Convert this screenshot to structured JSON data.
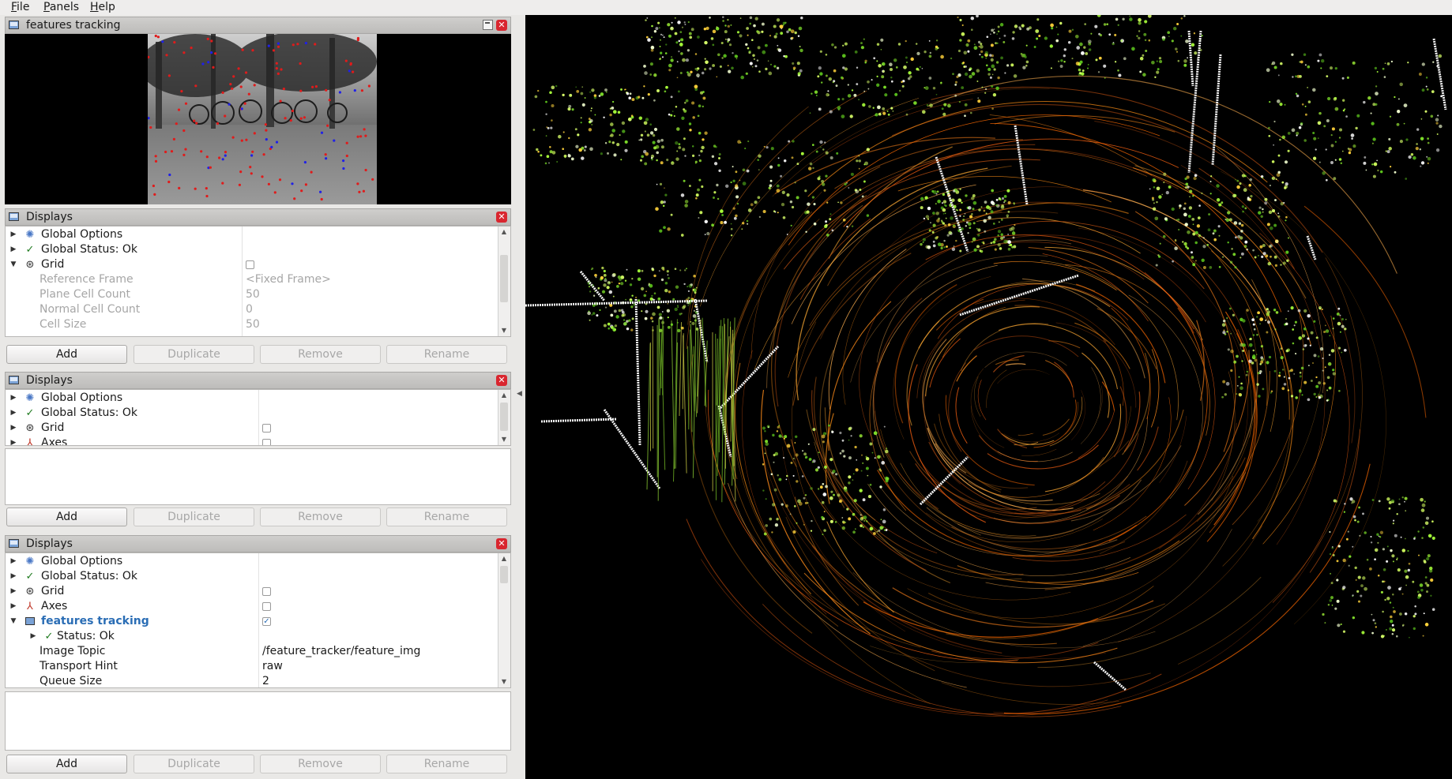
{
  "menubar": {
    "items": [
      {
        "label": "File",
        "accel": "F",
        "rest": "ile"
      },
      {
        "label": "Panels",
        "accel": "P",
        "rest": "anels"
      },
      {
        "label": "Help",
        "accel": "H",
        "rest": "elp"
      }
    ]
  },
  "image_panel": {
    "title": "features tracking",
    "icon": "image-icon"
  },
  "displays_panel_1": {
    "title": "Displays",
    "rows": [
      {
        "label": "Global Options",
        "icon": "globe-icon"
      },
      {
        "label": "Global Status: Ok",
        "icon": "check-icon"
      },
      {
        "label": "Grid",
        "icon": "grid-icon",
        "checked": false
      },
      {
        "label": "Reference Frame",
        "value": "<Fixed Frame>"
      },
      {
        "label": "Plane Cell Count",
        "value": "50"
      },
      {
        "label": "Normal Cell Count",
        "value": "0"
      },
      {
        "label": "Cell Size",
        "value": "50"
      }
    ],
    "buttons": {
      "add": "Add",
      "duplicate": "Duplicate",
      "remove": "Remove",
      "rename": "Rename"
    }
  },
  "displays_panel_2": {
    "title": "Displays",
    "rows": [
      {
        "label": "Global Options",
        "icon": "globe-icon"
      },
      {
        "label": "Global Status: Ok",
        "icon": "check-icon"
      },
      {
        "label": "Grid",
        "icon": "grid-icon",
        "checked": false
      },
      {
        "label": "Axes",
        "icon": "axes-icon",
        "checked": false
      }
    ],
    "buttons": {
      "add": "Add",
      "duplicate": "Duplicate",
      "remove": "Remove",
      "rename": "Rename"
    }
  },
  "displays_panel_3": {
    "title": "Displays",
    "rows": [
      {
        "label": "Global Options",
        "icon": "globe-icon"
      },
      {
        "label": "Global Status: Ok",
        "icon": "check-icon"
      },
      {
        "label": "Grid",
        "icon": "grid-icon",
        "checked": false
      },
      {
        "label": "Axes",
        "icon": "axes-icon",
        "checked": false
      },
      {
        "label": "features tracking",
        "icon": "image-icon",
        "checked": true
      },
      {
        "label": "Status: Ok",
        "icon": "check-icon"
      },
      {
        "label": "Image Topic",
        "value": "/feature_tracker/feature_img"
      },
      {
        "label": "Transport Hint",
        "value": "raw"
      },
      {
        "label": "Queue Size",
        "value": "2"
      }
    ],
    "buttons": {
      "add": "Add",
      "duplicate": "Duplicate",
      "remove": "Remove",
      "rename": "Rename"
    }
  },
  "colors": {
    "accent": "#2a6db5",
    "close": "#d9262f",
    "ok": "#1f7a1f",
    "view_background": "#000000"
  }
}
